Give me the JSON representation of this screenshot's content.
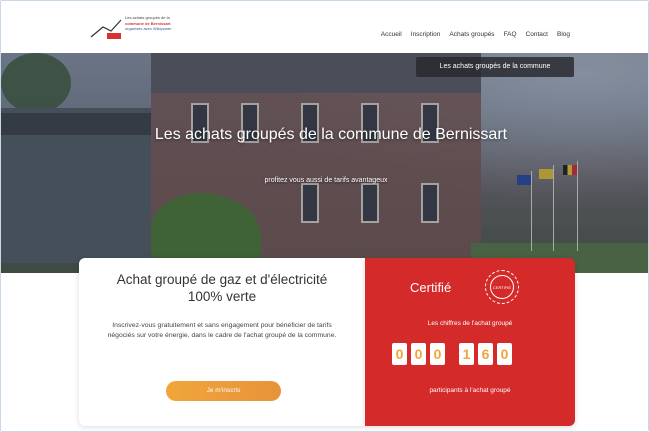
{
  "header": {
    "logo_lines": [
      "Les achats groupés de la",
      "commune de Bernissart",
      "organisés avec Wikipower"
    ],
    "nav": [
      "Accueil",
      "Inscription",
      "Achats groupés",
      "FAQ",
      "Contact",
      "Blog"
    ]
  },
  "hero": {
    "cta_label": "Les achats groupés de la commune",
    "title": "Les achats groupés de la commune de Bernissart",
    "subtitle": "profitez vous aussi de tarifs avantageux"
  },
  "offer_card": {
    "title": "Achat groupé de gaz et d'électricité 100% verte",
    "text": "Inscrivez-vous gratuitement et sans engagement pour bénéficier de tarifs négociés sur votre énergie, dans le cadre de l'achat groupé de la commune.",
    "button_label": "Je m'inscris"
  },
  "counter_card": {
    "label": "Certifié",
    "seal_text": "CERTIFIÉ",
    "text": "Les chiffres de l'achat groupé",
    "digits": [
      "0",
      "0",
      "0",
      "1",
      "6",
      "0"
    ],
    "caption": "participants à l'achat groupé"
  },
  "colors": {
    "accent_red": "#d42a2a",
    "accent_orange": "#f0a53a"
  }
}
